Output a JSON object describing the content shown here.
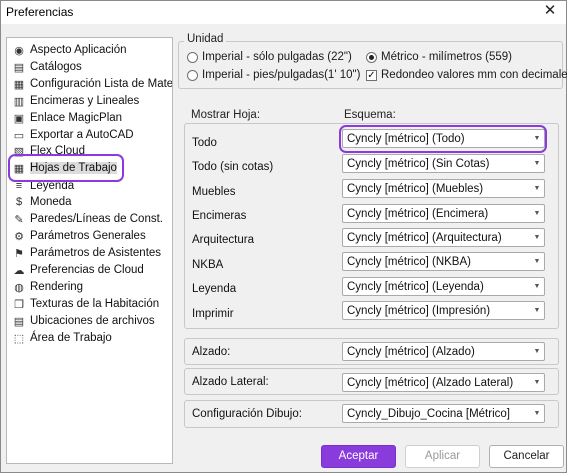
{
  "window": {
    "title": "Preferencias",
    "close_glyph": "✕"
  },
  "nav": {
    "items": [
      {
        "label": "Aspecto Aplicación",
        "icon": "eye-icon",
        "glyph": "◉"
      },
      {
        "label": "Catálogos",
        "icon": "catalog-icon",
        "glyph": "▤"
      },
      {
        "label": "Configuración Lista de Materia",
        "icon": "list-icon",
        "glyph": "▦"
      },
      {
        "label": "Encimeras y Lineales",
        "icon": "countertop-icon",
        "glyph": "▥"
      },
      {
        "label": "Enlace MagicPlan",
        "icon": "briefcase-icon",
        "glyph": "▣"
      },
      {
        "label": "Exportar a AutoCAD",
        "icon": "export-icon",
        "glyph": "▭"
      },
      {
        "label": "Flex Cloud",
        "icon": "flex-icon",
        "glyph": "▧"
      },
      {
        "label": "Hojas de Trabajo",
        "icon": "worksheet-icon",
        "glyph": "▦"
      },
      {
        "label": "Leyenda",
        "icon": "legend-icon",
        "glyph": "≡"
      },
      {
        "label": "Moneda",
        "icon": "currency-icon",
        "glyph": "$"
      },
      {
        "label": "Paredes/Líneas de Const.",
        "icon": "pencil-icon",
        "glyph": "✎"
      },
      {
        "label": "Parámetros Generales",
        "icon": "gear-icon",
        "glyph": "⚙"
      },
      {
        "label": "Parámetros de Asistentes",
        "icon": "flag-icon",
        "glyph": "⚑"
      },
      {
        "label": "Preferencias de Cloud",
        "icon": "cloud-icon",
        "glyph": "☁"
      },
      {
        "label": "Rendering",
        "icon": "sphere-icon",
        "glyph": "◍"
      },
      {
        "label": "Texturas de la Habitación",
        "icon": "cube-icon",
        "glyph": "❒"
      },
      {
        "label": "Ubicaciones de archivos",
        "icon": "folder-icon",
        "glyph": "▤"
      },
      {
        "label": "Área de Trabajo",
        "icon": "workspace-icon",
        "glyph": "⬚"
      }
    ],
    "selected_index": 7
  },
  "units": {
    "legend": "Unidad",
    "imperial_inches": "Imperial - sólo pulgadas (22\")",
    "metric_mm": "Métrico - milímetros (559)",
    "imperial_feet": "Imperial - pies/pulgadas(1' 10\")",
    "round_mm": "Redondeo valores mm con decimales",
    "selected": "metric_mm",
    "round_checked": true
  },
  "headers": {
    "show_sheet": "Mostrar Hoja:",
    "scheme": "Esquema:"
  },
  "sheets": [
    {
      "label": "Todo",
      "value": "Cyncly [métrico] (Todo)"
    },
    {
      "label": "Todo (sin cotas)",
      "value": "Cyncly [métrico] (Sin Cotas)"
    },
    {
      "label": "Muebles",
      "value": "Cyncly [métrico] (Muebles)"
    },
    {
      "label": "Encimeras",
      "value": "Cyncly [métrico] (Encimera)"
    },
    {
      "label": "Arquitectura",
      "value": "Cyncly [métrico] (Arquitectura)"
    },
    {
      "label": "NKBA",
      "value": "Cyncly [métrico] (NKBA)"
    },
    {
      "label": "Leyenda",
      "value": "Cyncly [métrico] (Leyenda)"
    },
    {
      "label": "Imprimir",
      "value": "Cyncly [métrico] (Impresión)"
    }
  ],
  "elevation": {
    "label": "Alzado:",
    "value": "Cyncly [métrico] (Alzado)"
  },
  "side_elevation": {
    "label": "Alzado Lateral:",
    "value": "Cyncly [métrico] (Alzado Lateral)"
  },
  "drawing_config": {
    "label": "Configuración Dibujo:",
    "value": "Cyncly_Dibujo_Cocina [Métrico]"
  },
  "buttons": {
    "accept": "Aceptar",
    "apply": "Aplicar",
    "cancel": "Cancelar"
  },
  "colors": {
    "accent": "#8a3bdc"
  }
}
